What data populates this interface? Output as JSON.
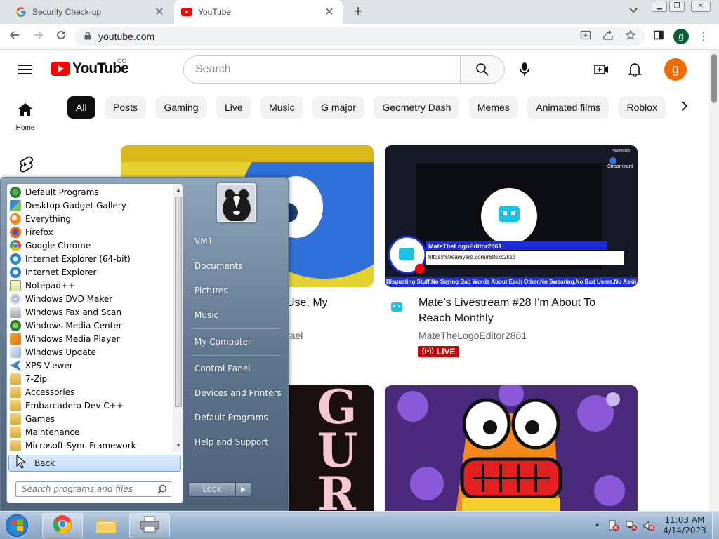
{
  "browser": {
    "tabs": [
      {
        "title": "Security Check-up",
        "favicon": "google-g-icon",
        "active": false
      },
      {
        "title": "YouTube",
        "favicon": "youtube-icon",
        "active": true
      }
    ],
    "url": "youtube.com",
    "profile_initial": "g"
  },
  "youtube": {
    "logo_text": "YouTube",
    "country_code": "CO",
    "search_placeholder": "Search",
    "avatar_initial": "g",
    "guide": {
      "home_label": "Home"
    },
    "chips": [
      "All",
      "Posts",
      "Gaming",
      "Live",
      "Music",
      "G major",
      "Geometry Dash",
      "Memes",
      "Animated films",
      "Roblox"
    ],
    "videos": [
      {
        "title_fragment": "Use, My",
        "channel_fragment": "rael"
      },
      {
        "title": "Mate's Livestream #28 I'm About To Reach Monthly",
        "channel": "MateTheLogoEditor2861",
        "badge": "LIVE",
        "thumb_channel": "MateTheLogoEditor2861",
        "thumb_link": "https://streamyard.com/r68sxc2ksc",
        "thumb_ticker": "Disgusting Stuff,No Saying Bad Words About Each Other,No Swearing,No Bad Users,No Asking To",
        "thumb_brand": "StreamYard",
        "thumb_brand_prefix": "Powered by"
      },
      {
        "title_fragment": "GUR"
      },
      {}
    ],
    "accent_color": "#ff0000"
  },
  "start_menu": {
    "programs": [
      {
        "label": "Default Programs",
        "icon": "default-programs-icon"
      },
      {
        "label": "Desktop Gadget Gallery",
        "icon": "gadget-icon"
      },
      {
        "label": "Everything",
        "icon": "everything-search-icon"
      },
      {
        "label": "Firefox",
        "icon": "firefox-icon"
      },
      {
        "label": "Google Chrome",
        "icon": "chrome-icon"
      },
      {
        "label": "Internet Explorer (64-bit)",
        "icon": "ie-icon"
      },
      {
        "label": "Internet Explorer",
        "icon": "ie-icon"
      },
      {
        "label": "Notepad++",
        "icon": "notepadpp-icon"
      },
      {
        "label": "Windows DVD Maker",
        "icon": "dvd-maker-icon"
      },
      {
        "label": "Windows Fax and Scan",
        "icon": "fax-icon"
      },
      {
        "label": "Windows Media Center",
        "icon": "media-center-icon"
      },
      {
        "label": "Windows Media Player",
        "icon": "media-player-icon"
      },
      {
        "label": "Windows Update",
        "icon": "windows-update-icon"
      },
      {
        "label": "XPS Viewer",
        "icon": "xps-viewer-icon"
      },
      {
        "label": "7-Zip",
        "icon": "folder-icon"
      },
      {
        "label": "Accessories",
        "icon": "folder-icon"
      },
      {
        "label": "Embarcadero Dev-C++",
        "icon": "folder-icon"
      },
      {
        "label": "Games",
        "icon": "folder-icon"
      },
      {
        "label": "Maintenance",
        "icon": "folder-icon"
      },
      {
        "label": "Microsoft Sync Framework",
        "icon": "folder-icon"
      }
    ],
    "back_label": "Back",
    "search_placeholder": "Search programs and files",
    "right_items": [
      "VM1",
      "Documents",
      "Pictures",
      "Music",
      "My Computer",
      "Control Panel",
      "Devices and Printers",
      "Default Programs",
      "Help and Support"
    ],
    "lock_label": "Lock"
  },
  "taskbar": {
    "pinned": [
      "chrome-icon",
      "explorer-icon",
      "printer-icon"
    ],
    "time": "11:03 AM",
    "date": "4/14/2023"
  }
}
